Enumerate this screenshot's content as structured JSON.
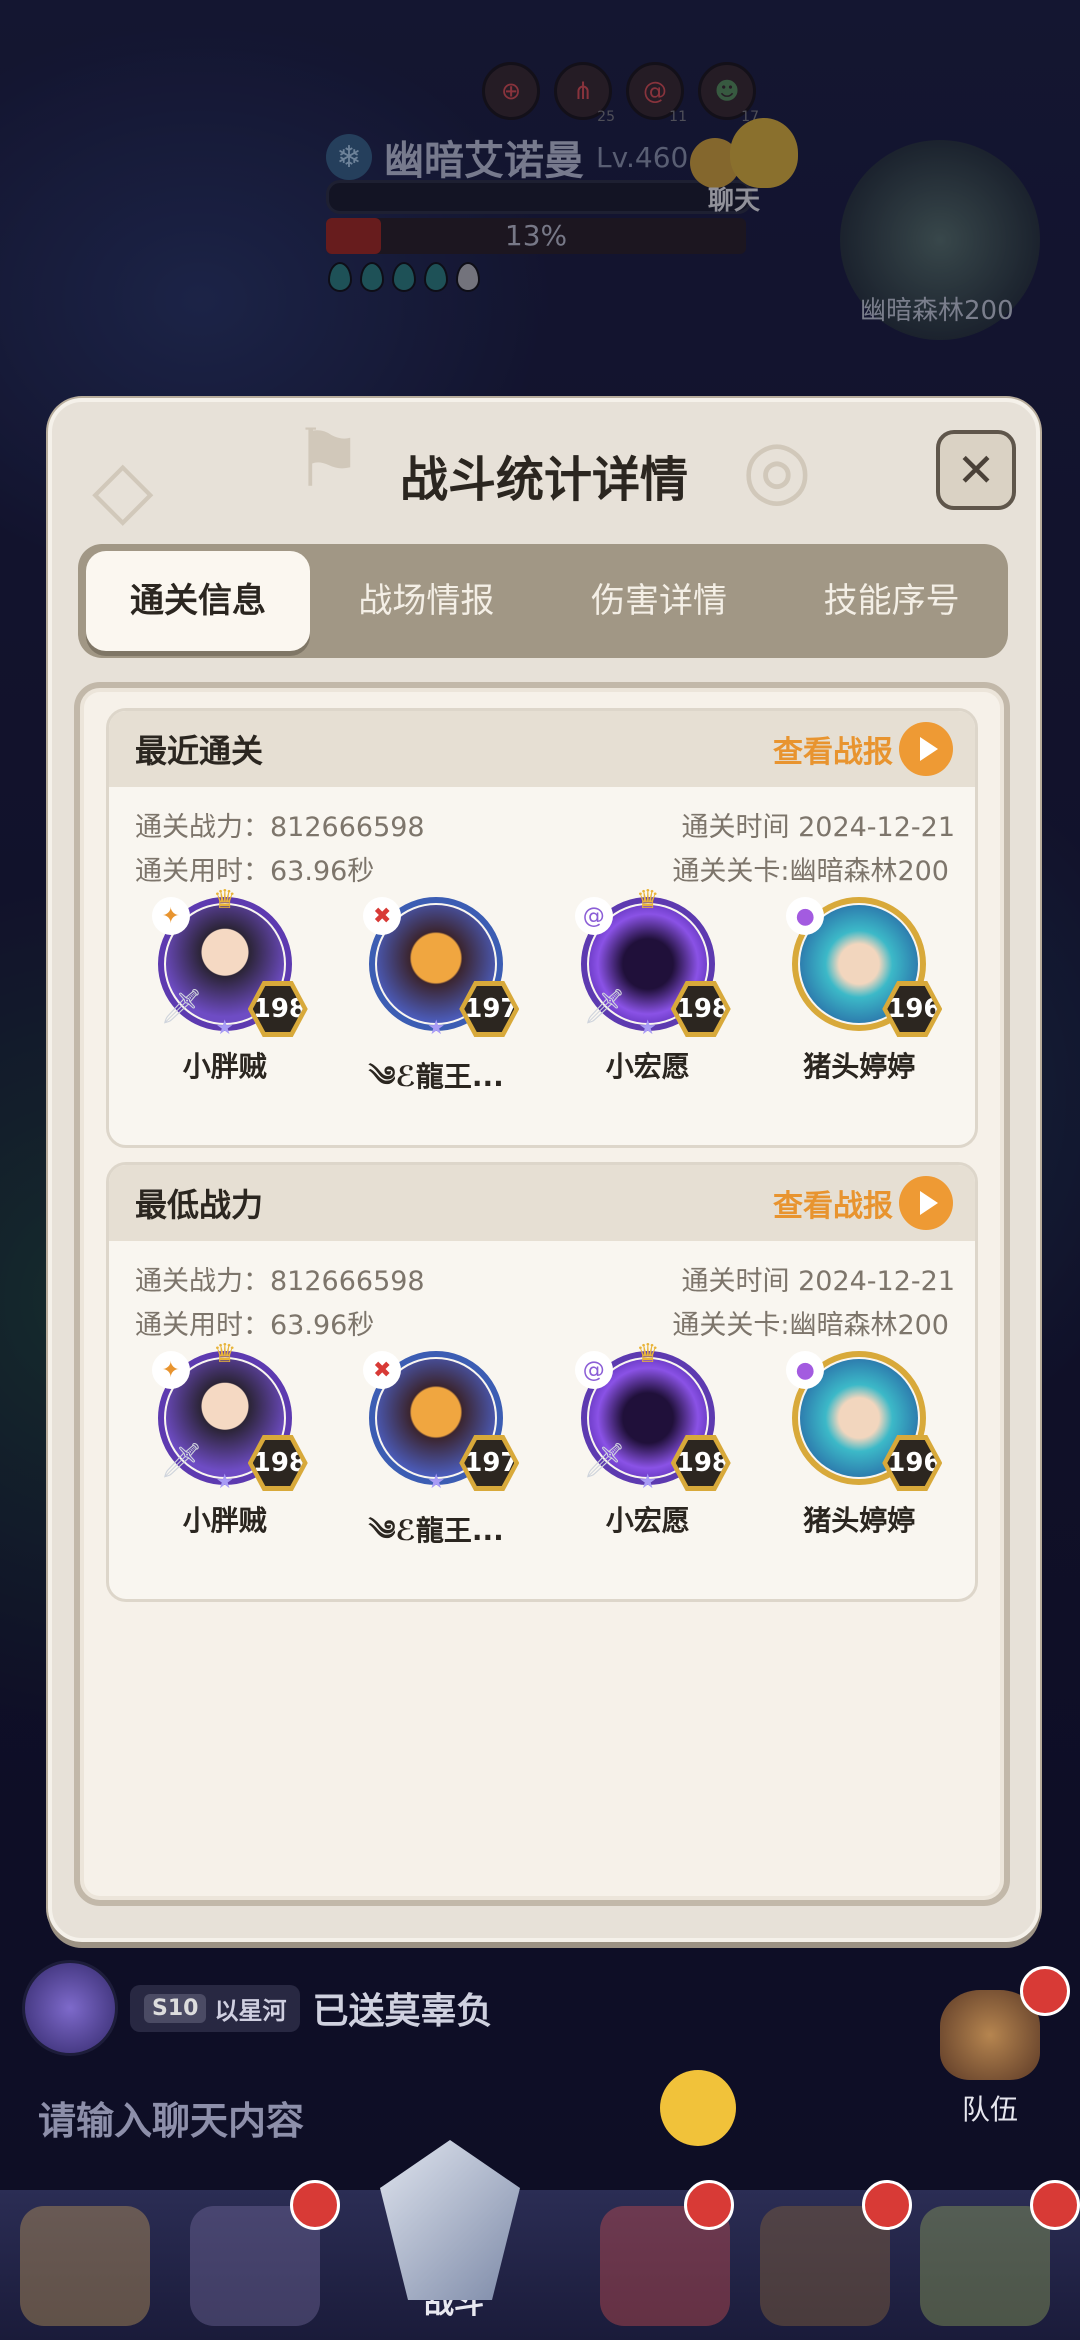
{
  "hud": {
    "icons": [
      {
        "name": "crosshair-icon",
        "count": ""
      },
      {
        "name": "claw-icon",
        "count": "25"
      },
      {
        "name": "swirl-icon",
        "count": "11"
      },
      {
        "name": "skull-icon",
        "count": "17"
      }
    ],
    "boss_name": "幽暗艾诺曼",
    "boss_level": "Lv.460",
    "progress_percent_text": "13%",
    "progress_fraction": 0.13,
    "chat_label": "聊天",
    "minimap_label": "幽暗森林200"
  },
  "modal": {
    "title": "战斗统计详情",
    "close_icon": "close-icon",
    "tabs": [
      {
        "label": "通关信息",
        "active": true
      },
      {
        "label": "战场情报",
        "active": false
      },
      {
        "label": "伤害详情",
        "active": false
      },
      {
        "label": "技能序号",
        "active": false
      }
    ],
    "cards": [
      {
        "title": "最近通关",
        "replay_label": "查看战报",
        "power": "通关战力：812666598",
        "time": "通关时间  2024-12-21",
        "duration": "通关用时：63.96秒",
        "stage": "通关关卡:幽暗森林200",
        "heroes": [
          {
            "name": "小胖贼",
            "level": "198"
          },
          {
            "name": "༄ℰ龍王...",
            "level": "197"
          },
          {
            "name": "小宏愿",
            "level": "198"
          },
          {
            "name": "猪头婷婷",
            "level": "196"
          }
        ]
      },
      {
        "title": "最低战力",
        "replay_label": "查看战报",
        "power": "通关战力：812666598",
        "time": "通关时间  2024-12-21",
        "duration": "通关用时：63.96秒",
        "stage": "通关关卡:幽暗森林200",
        "heroes": [
          {
            "name": "小胖贼",
            "level": "198"
          },
          {
            "name": "༄ℰ龍王...",
            "level": "197"
          },
          {
            "name": "小宏愿",
            "level": "198"
          },
          {
            "name": "猪头婷婷",
            "level": "196"
          }
        ]
      }
    ]
  },
  "chat": {
    "season_badge": "S10",
    "sender": "以星河",
    "message": "已送莫辜负",
    "input_placeholder": "请输入聊天内容",
    "team_label": "队伍"
  },
  "nav": {
    "battle_label": "战斗"
  },
  "colors": {
    "accent_orange": "#ee9a34",
    "panel_bg": "#f6f1e9",
    "tab_bar": "#a19785"
  }
}
